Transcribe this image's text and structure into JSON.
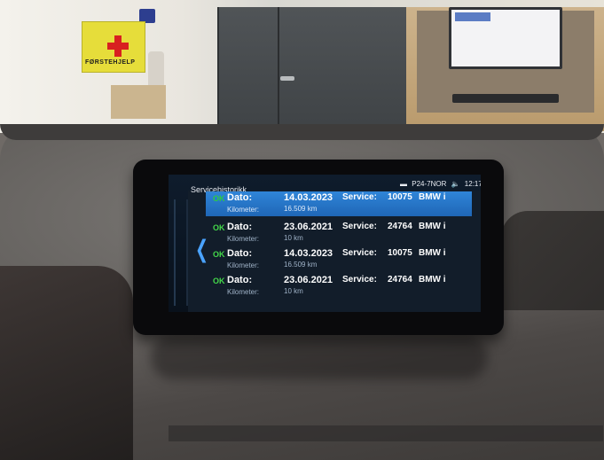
{
  "background": {
    "first_aid_label": "FØRSTEHJELP"
  },
  "display": {
    "title": "Servicehistorikk",
    "status": {
      "plate": "P24-7NOR",
      "time": "12:17"
    },
    "back_icon": "chevron-left-icon",
    "colors": {
      "ok": "#44d84a",
      "selected": "#2f85d8",
      "back": "#4aa3ff"
    },
    "rows": [
      {
        "ok": "OK",
        "dato_label": "Dato:",
        "date": "14.03.2023",
        "km_label": "Kilometer:",
        "km": "16.509 km",
        "service_label": "Service:",
        "service_no": "10075",
        "brand": "BMW i",
        "selected": true
      },
      {
        "ok": "OK",
        "dato_label": "Dato:",
        "date": "23.06.2021",
        "km_label": "Kilometer:",
        "km": "10 km",
        "service_label": "Service:",
        "service_no": "24764",
        "brand": "BMW i",
        "selected": false
      },
      {
        "ok": "OK",
        "dato_label": "Dato:",
        "date": "14.03.2023",
        "km_label": "Kilometer:",
        "km": "16.509 km",
        "service_label": "Service:",
        "service_no": "10075",
        "brand": "BMW i",
        "selected": false
      },
      {
        "ok": "OK",
        "dato_label": "Dato:",
        "date": "23.06.2021",
        "km_label": "Kilometer:",
        "km": "10 km",
        "service_label": "Service:",
        "service_no": "24764",
        "brand": "BMW i",
        "selected": false
      }
    ]
  }
}
